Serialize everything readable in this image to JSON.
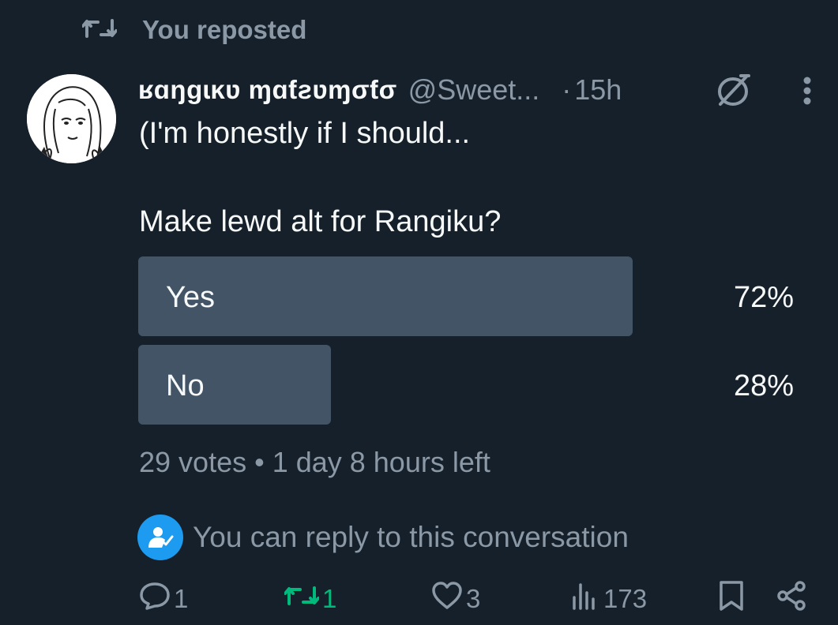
{
  "repost": {
    "label": "You reposted"
  },
  "author": {
    "display_name": "ʁɑŋɡɩĸʋ ɱɑƭƨʋɱσƭσ",
    "handle": "@Sweet...",
    "separator": "·",
    "time": "15h"
  },
  "tweet": {
    "text": "(I'm honestly if I should...",
    "question": "Make lewd alt for Rangiku?"
  },
  "poll": {
    "options": [
      {
        "label": "Yes",
        "percent_text": "72%",
        "percent": 72
      },
      {
        "label": "No",
        "percent_text": "28%",
        "percent": 28
      }
    ],
    "meta": "29 votes • 1 day 8 hours left"
  },
  "reply_info": {
    "text": "You can reply to this conversation"
  },
  "actions": {
    "replies": "1",
    "reposts": "1",
    "likes": "3",
    "views": "173"
  },
  "colors": {
    "background": "#15202b",
    "secondary_text": "#8b98a5",
    "poll_bar": "#425466",
    "repost_active": "#00ba7c",
    "accent": "#1d9bf0"
  },
  "icons": [
    "repost-icon",
    "verified-off-icon",
    "more-icon",
    "reply-restriction-icon",
    "reply-icon",
    "repost-icon",
    "like-icon",
    "views-icon",
    "bookmark-icon",
    "share-icon"
  ]
}
